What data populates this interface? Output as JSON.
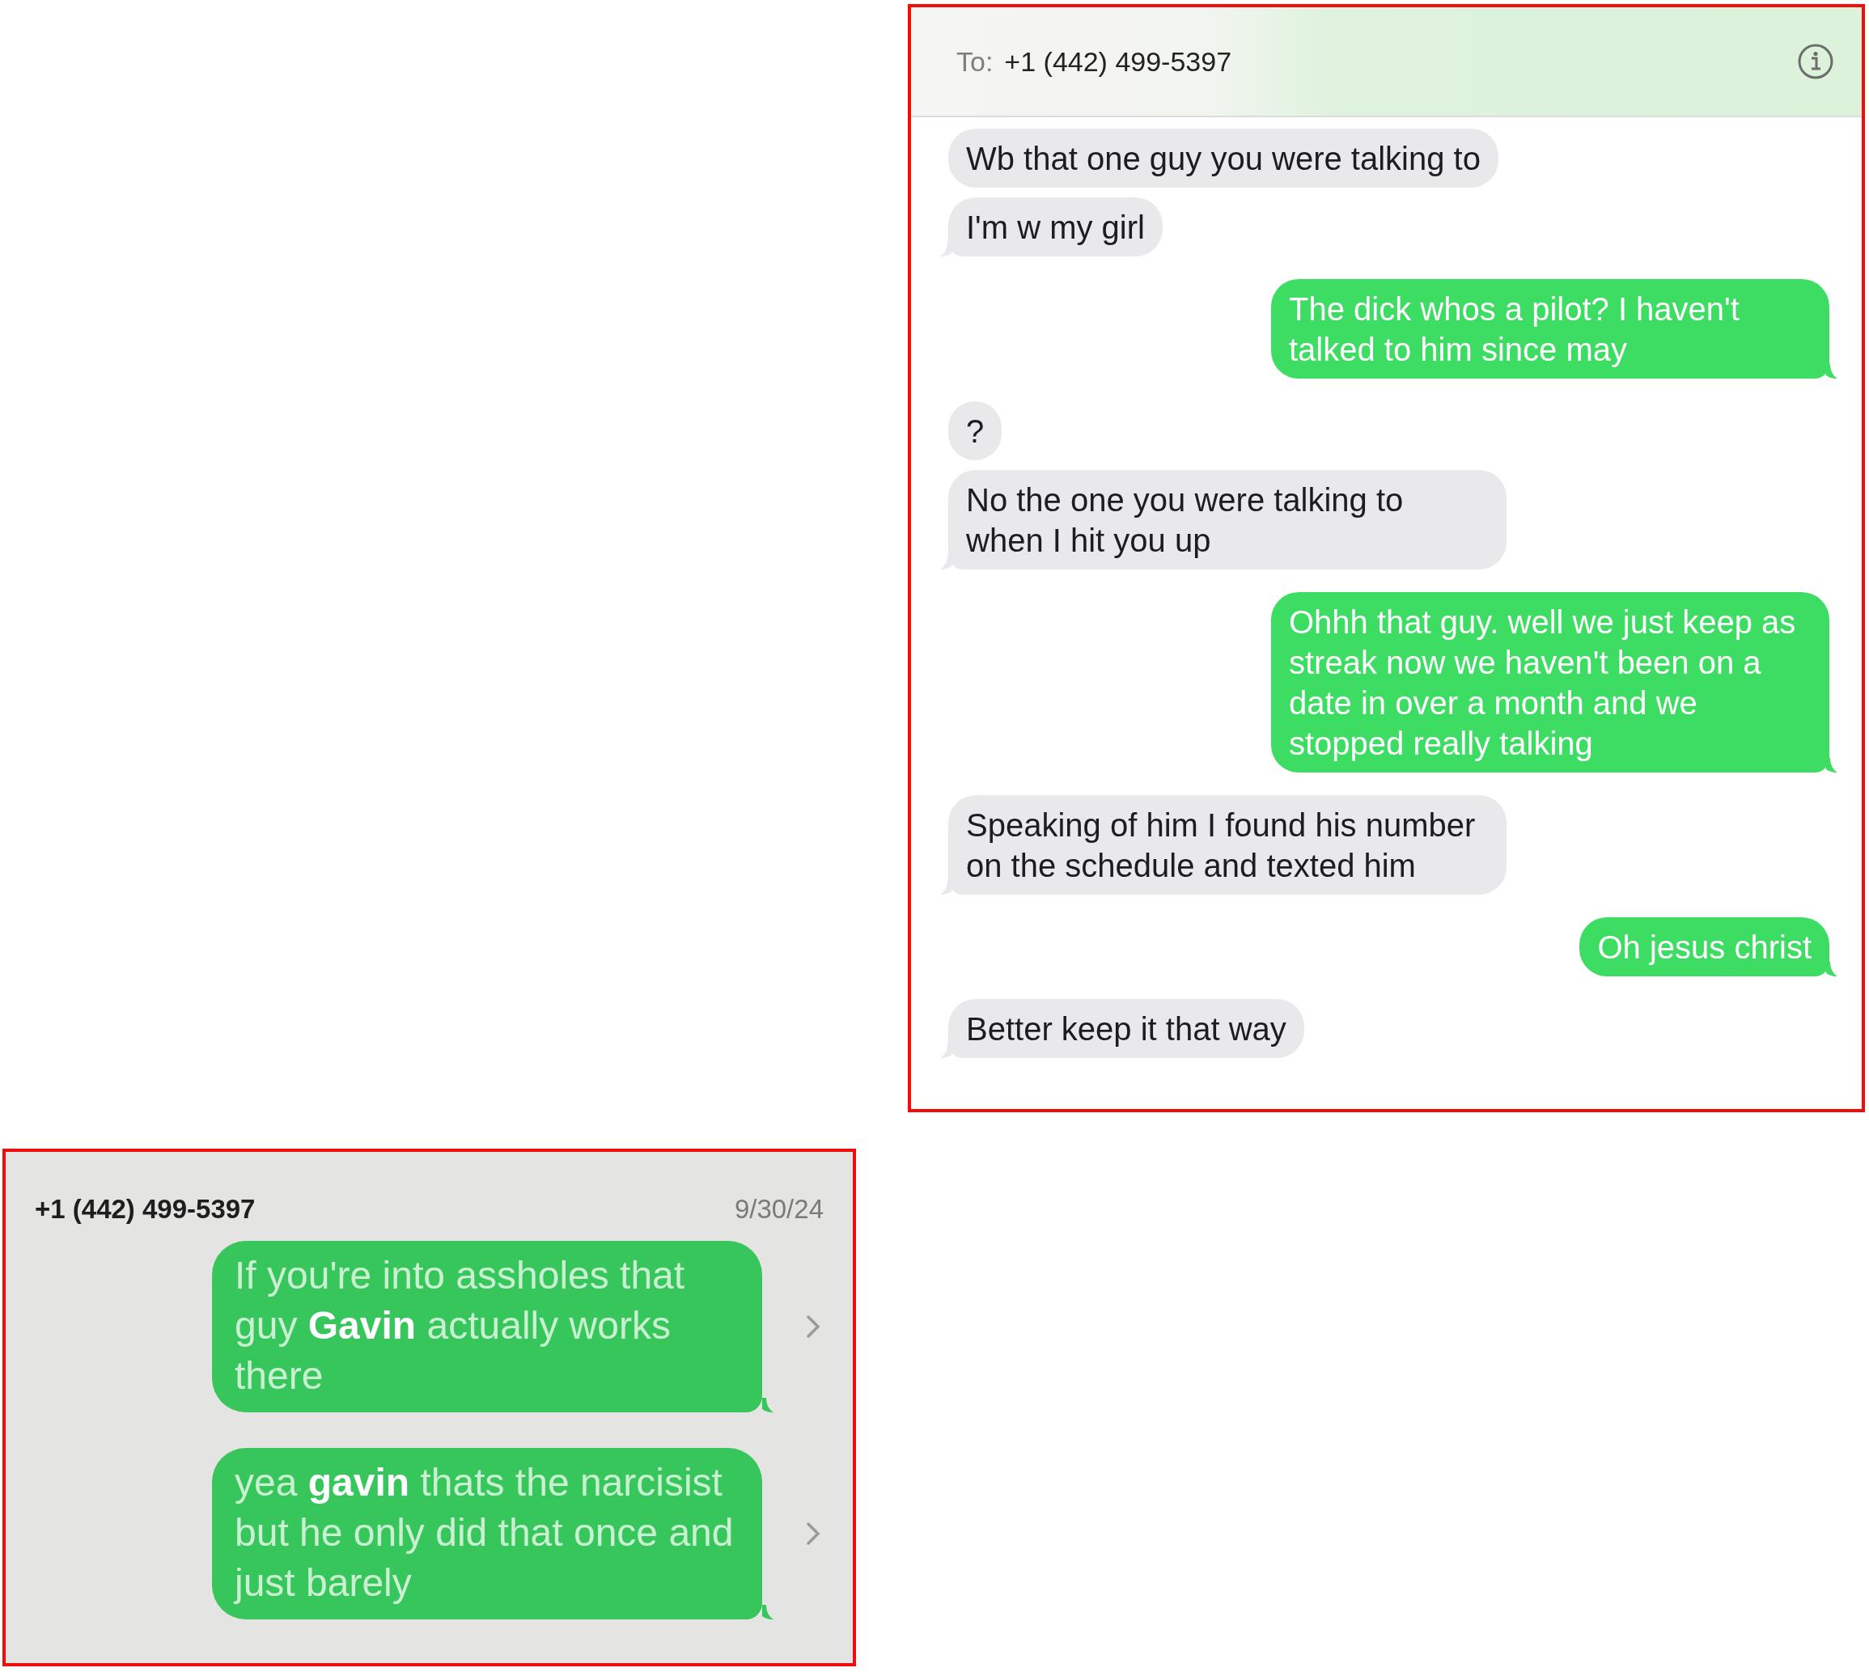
{
  "conversation": {
    "to_label": "To:",
    "recipient": "+1 (442) 499-5397",
    "messages": [
      {
        "kind": "received",
        "tail": false,
        "text": "Wb that one guy you were talking to"
      },
      {
        "kind": "received",
        "tail": true,
        "text": "I'm w my girl"
      },
      {
        "kind": "sent",
        "tail": true,
        "text": "The dick whos a pilot? I haven't talked to him since may"
      },
      {
        "kind": "received",
        "tail": false,
        "text": "?"
      },
      {
        "kind": "received",
        "tail": true,
        "text": "No the one you were talking to when I hit you up"
      },
      {
        "kind": "sent",
        "tail": true,
        "text": "Ohhh that guy. well we just keep as streak now we haven't been on a date in over a month and we stopped really talking"
      },
      {
        "kind": "received",
        "tail": true,
        "text": "Speaking of him I found his number on the schedule and texted him"
      },
      {
        "kind": "sent",
        "tail": true,
        "text": "Oh jesus christ"
      },
      {
        "kind": "received",
        "tail": true,
        "text": "Better keep it that way"
      }
    ]
  },
  "preview": {
    "contact": "+1 (442) 499-5397",
    "date": "9/30/24",
    "messages": [
      {
        "text": "If you're into assholes that guy **Gavin** actually works there"
      },
      {
        "text": "yea **gavin** thats the narcisist but he only did that once and just barely"
      }
    ]
  }
}
